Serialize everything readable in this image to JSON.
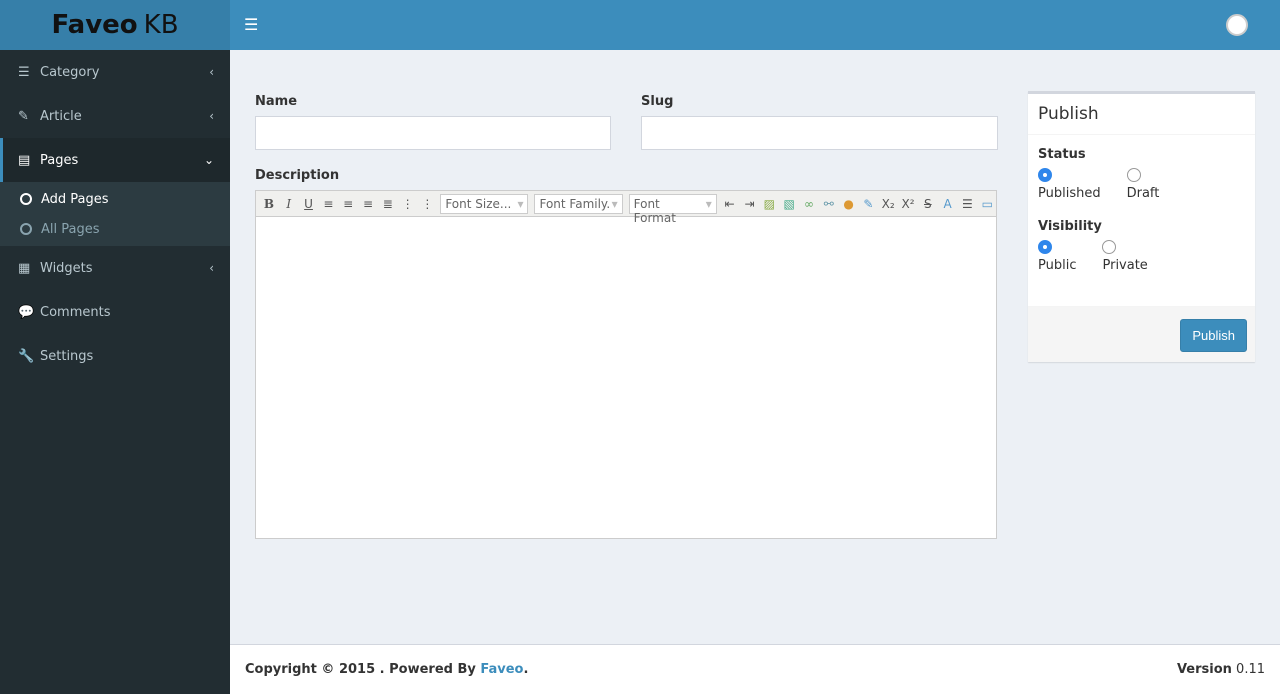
{
  "brand": {
    "bold": "Faveo",
    "light": "KB"
  },
  "sidebar": {
    "items": [
      {
        "label": "Category",
        "icon": "list-icon"
      },
      {
        "label": "Article",
        "icon": "edit-icon"
      },
      {
        "label": "Pages",
        "icon": "file-icon"
      },
      {
        "label": "Widgets",
        "icon": "grid-icon"
      },
      {
        "label": "Comments",
        "icon": "comments-icon"
      },
      {
        "label": "Settings",
        "icon": "wrench-icon"
      }
    ],
    "sub": [
      {
        "label": "Add Pages"
      },
      {
        "label": "All Pages"
      }
    ]
  },
  "form": {
    "name_label": "Name",
    "slug_label": "Slug",
    "description_label": "Description",
    "name_value": "",
    "slug_value": ""
  },
  "editor": {
    "font_size": "Font Size...",
    "font_family": "Font Family.",
    "font_format": "Font Format"
  },
  "publish": {
    "title": "Publish",
    "status_label": "Status",
    "status_options": [
      "Published",
      "Draft"
    ],
    "status_selected": "Published",
    "visibility_label": "Visibility",
    "visibility_options": [
      "Public",
      "Private"
    ],
    "visibility_selected": "Public",
    "button": "Publish"
  },
  "footer": {
    "copyright": "Copyright © 2015 . Powered By ",
    "link": "Faveo",
    "dot": ".",
    "version_label": "Version",
    "version": "0.11"
  },
  "colors": {
    "primary": "#3c8dbc",
    "sidebar": "#222d32"
  }
}
